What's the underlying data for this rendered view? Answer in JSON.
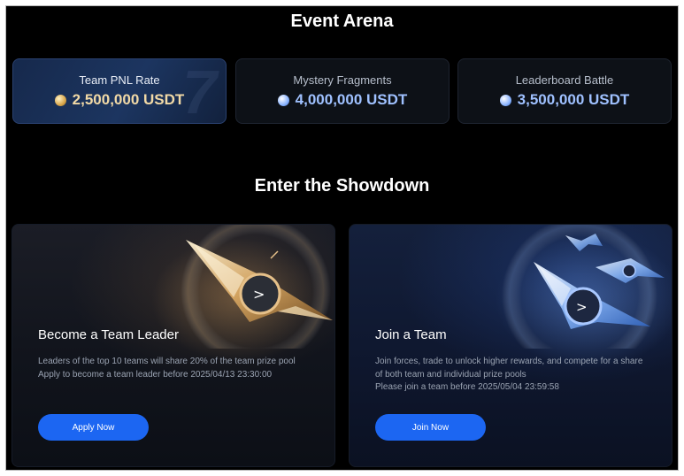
{
  "arena": {
    "title": "Event Arena",
    "pools": [
      {
        "label": "Team PNL Rate",
        "value": "2,500,000 USDT",
        "icon": "gold-coin-icon"
      },
      {
        "label": "Mystery Fragments",
        "value": "4,000,000 USDT",
        "icon": "blue-token-icon"
      },
      {
        "label": "Leaderboard Battle",
        "value": "3,500,000 USDT",
        "icon": "blue-token-icon"
      }
    ],
    "pool_decor": "7"
  },
  "showdown": {
    "title": "Enter the Showdown",
    "cards": [
      {
        "title": "Become a Team Leader",
        "lines": [
          "Leaders of the top 10 teams will share 20% of the team prize pool",
          "Apply to become a team leader before 2025/04/13 23:30:00"
        ],
        "button": "Apply Now",
        "art": "gold-spaceship-icon"
      },
      {
        "title": "Join a Team",
        "lines": [
          "Join forces, trade to unlock higher rewards, and compete for a share",
          "of both team and individual prize pools",
          "Please join a team before 2025/05/04 23:59:58"
        ],
        "button": "Join Now",
        "art": "blue-spaceship-fleet-icon"
      }
    ]
  },
  "colors": {
    "background": "#000000",
    "accent_button": "#1c66f2",
    "gold_value": "#f1d9a6",
    "blue_value": "#9fc1ff"
  }
}
